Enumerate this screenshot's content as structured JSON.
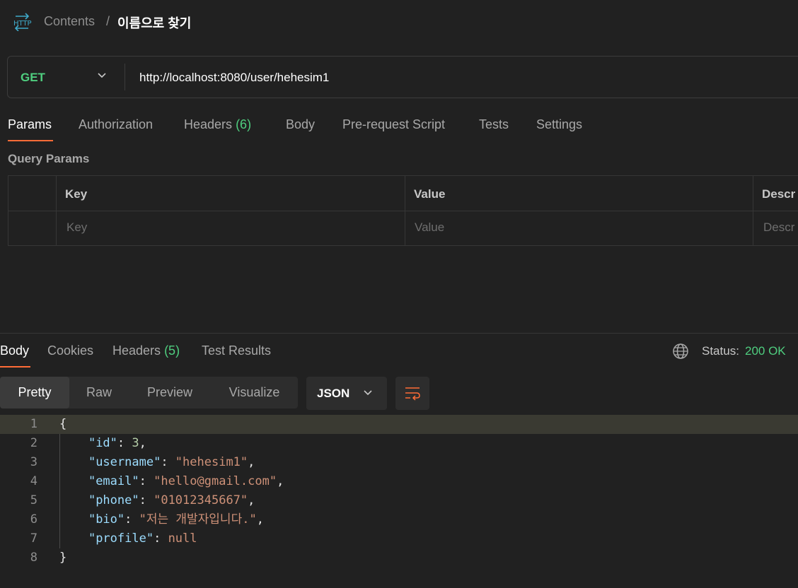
{
  "breadcrumb": {
    "icon": "http-icon",
    "parent": "Contents",
    "separator": "/",
    "current": "이름으로 찾기"
  },
  "request": {
    "method": "GET",
    "url": "http://localhost:8080/user/hehesim1",
    "tabs": [
      {
        "label": "Params",
        "active": true
      },
      {
        "label": "Authorization"
      },
      {
        "label": "Headers",
        "count": "(6)"
      },
      {
        "label": "Body"
      },
      {
        "label": "Pre-request Script"
      },
      {
        "label": "Tests"
      },
      {
        "label": "Settings"
      }
    ],
    "query_params": {
      "title": "Query Params",
      "headers": [
        "Key",
        "Value",
        "Descr"
      ],
      "placeholders": [
        "Key",
        "Value",
        "Descr"
      ]
    }
  },
  "response": {
    "tabs": [
      {
        "label": "Body",
        "active": true
      },
      {
        "label": "Cookies"
      },
      {
        "label": "Headers",
        "count": "(5)"
      },
      {
        "label": "Test Results"
      }
    ],
    "status_label": "Status:",
    "status_value": "200 OK",
    "view_modes": [
      "Pretty",
      "Raw",
      "Preview",
      "Visualize"
    ],
    "active_view": "Pretty",
    "format": "JSON",
    "line_numbers": [
      "1",
      "2",
      "3",
      "4",
      "5",
      "6",
      "7",
      "8"
    ],
    "code": [
      {
        "parts": [
          [
            "p",
            "{"
          ]
        ]
      },
      {
        "parts": [
          [
            "p",
            "    "
          ],
          [
            "k",
            "\"id\""
          ],
          [
            "p",
            ": "
          ],
          [
            "n",
            "3"
          ],
          [
            "p",
            ","
          ]
        ]
      },
      {
        "parts": [
          [
            "p",
            "    "
          ],
          [
            "k",
            "\"username\""
          ],
          [
            "p",
            ": "
          ],
          [
            "s",
            "\"hehesim1\""
          ],
          [
            "p",
            ","
          ]
        ]
      },
      {
        "parts": [
          [
            "p",
            "    "
          ],
          [
            "k",
            "\"email\""
          ],
          [
            "p",
            ": "
          ],
          [
            "s",
            "\"hello@gmail.com\""
          ],
          [
            "p",
            ","
          ]
        ]
      },
      {
        "parts": [
          [
            "p",
            "    "
          ],
          [
            "k",
            "\"phone\""
          ],
          [
            "p",
            ": "
          ],
          [
            "s",
            "\"01012345667\""
          ],
          [
            "p",
            ","
          ]
        ]
      },
      {
        "parts": [
          [
            "p",
            "    "
          ],
          [
            "k",
            "\"bio\""
          ],
          [
            "p",
            ": "
          ],
          [
            "s",
            "\"저는 개발자입니다.\""
          ],
          [
            "p",
            ","
          ]
        ]
      },
      {
        "parts": [
          [
            "p",
            "    "
          ],
          [
            "k",
            "\"profile\""
          ],
          [
            "p",
            ": "
          ],
          [
            "nl",
            "null"
          ]
        ]
      },
      {
        "parts": [
          [
            "p",
            "}"
          ]
        ]
      }
    ]
  },
  "colors": {
    "accent": "#ff6c37",
    "green": "#4fce7f",
    "background": "#212121"
  }
}
